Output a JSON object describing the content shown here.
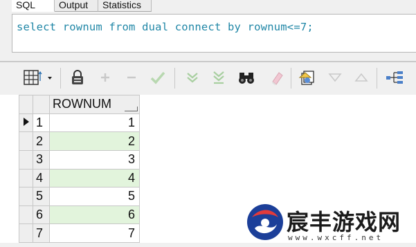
{
  "tabs": [
    "SQL",
    "Output",
    "Statistics"
  ],
  "editor": {
    "sql": "select rownum from dual connect by rownum<=7;"
  },
  "toolbar": {
    "icons": [
      "grid-layout-icon",
      "lock-icon",
      "plus-icon",
      "minus-icon",
      "check-icon",
      "next-page-icon",
      "last-page-icon",
      "binoculars-icon",
      "eraser-icon",
      "export-icon",
      "triangle-down-icon",
      "triangle-up-icon",
      "query-plan-icon"
    ]
  },
  "grid": {
    "column": "ROWNUM",
    "rows": [
      {
        "num": "1",
        "value": "1"
      },
      {
        "num": "2",
        "value": "2"
      },
      {
        "num": "3",
        "value": "3"
      },
      {
        "num": "4",
        "value": "4"
      },
      {
        "num": "5",
        "value": "5"
      },
      {
        "num": "6",
        "value": "6"
      },
      {
        "num": "7",
        "value": "7"
      }
    ]
  },
  "watermark": {
    "title": "宸丰游戏网",
    "url": "www.wxcff.net"
  }
}
